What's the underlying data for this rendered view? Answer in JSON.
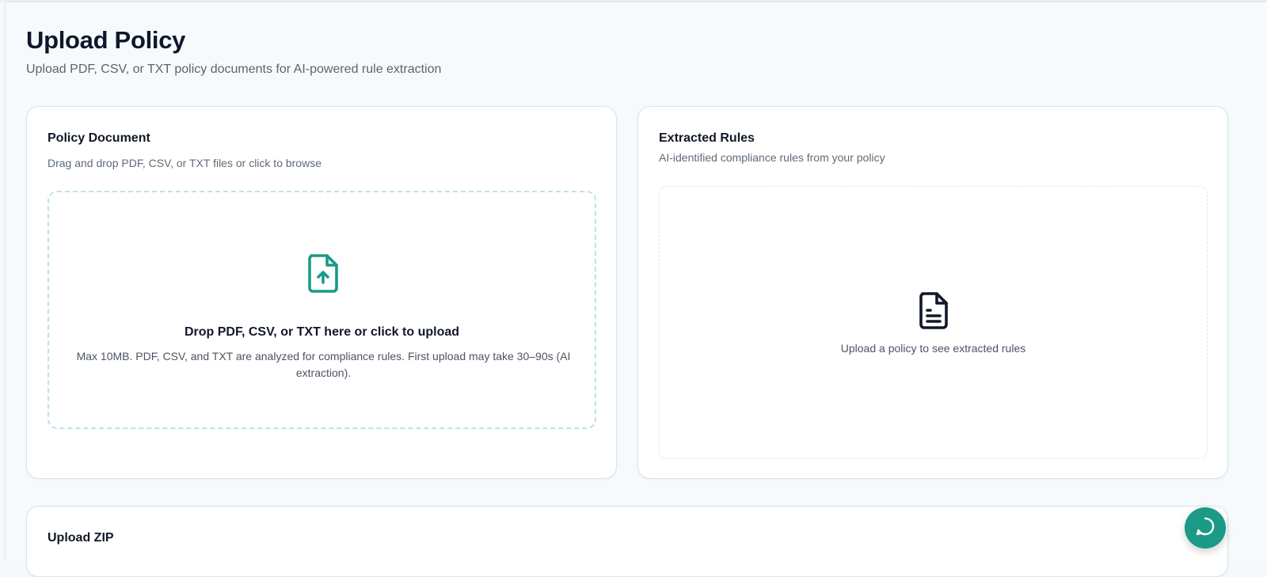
{
  "header": {
    "title": "Upload Policy",
    "subtitle": "Upload PDF, CSV, or TXT policy documents for AI-powered rule extraction"
  },
  "policy_card": {
    "title": "Policy Document",
    "description": "Drag and drop PDF, CSV, or TXT files or click to browse",
    "dropzone": {
      "icon": "file-upload-icon",
      "title": "Drop PDF, CSV, or TXT here or click to upload",
      "note": "Max 10MB. PDF, CSV, and TXT are analyzed for compliance rules. First upload may take 30–90s (AI extraction)."
    }
  },
  "rules_card": {
    "title": "Extracted Rules",
    "description": "AI-identified compliance rules from your policy",
    "empty_icon": "document-text-icon",
    "empty_text": "Upload a policy to see extracted rules"
  },
  "zip_card": {
    "title": "Upload ZIP"
  },
  "chat_button": {
    "icon": "chat-bubble-icon"
  },
  "colors": {
    "accent": "#1b9a87",
    "border": "#d3e6ef",
    "dropzone_border": "#bfe0ee",
    "background": "#f7fafc"
  }
}
